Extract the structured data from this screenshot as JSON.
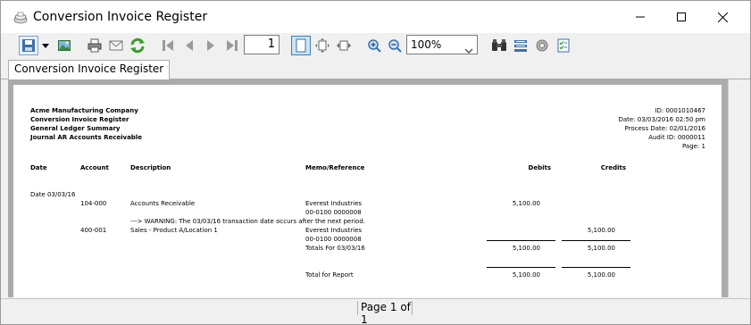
{
  "window": {
    "title": "Conversion Invoice Register",
    "controls": [
      "minimize",
      "maximize",
      "close"
    ]
  },
  "toolbar": {
    "icons": [
      "save-icon",
      "dropdown-arrow-icon",
      "export-image-icon",
      "print-icon",
      "email-icon",
      "refresh-icon",
      "first-page-icon",
      "previous-page-icon",
      "next-page-icon",
      "last-page-icon",
      "single-page-view-icon",
      "fit-page-icon",
      "fit-width-icon",
      "zoom-in-icon",
      "zoom-out-icon",
      "find-icon",
      "group-tree-icon",
      "settings-icon",
      "checklist-icon"
    ],
    "page_number": "1",
    "zoom": "100%"
  },
  "tabs": [
    {
      "label": "Conversion Invoice Register",
      "active": true
    }
  ],
  "report": {
    "header_left": [
      "Acme Manufacturing Company",
      "Conversion Invoice Register",
      "General Ledger Summary",
      "Journal AR Accounts Receivable"
    ],
    "header_right": [
      "ID: 0001010467",
      "Date: 03/03/2016 02:50 pm",
      "Process Date: 02/01/2016",
      "Audit ID: 0000011",
      "Page: 1"
    ],
    "columns": {
      "date": "Date",
      "account": "Account",
      "description": "Description",
      "memo": "Memo/Reference",
      "debits": "Debits",
      "credits": "Credits"
    },
    "group_date": "Date 03/03/16",
    "rows": [
      {
        "account": "104-000",
        "description": "Accounts Receivable",
        "memo": "Everest Industries",
        "debit": "5,100.00",
        "credit": ""
      },
      {
        "memo": "00-0100   0000008"
      },
      {
        "description": "---> WARNING: The 03/03/16 transaction date occurs after the next period."
      },
      {
        "account": "400-001",
        "description": "Sales - Product A/Location 1",
        "memo": "Everest Industries",
        "debit": "",
        "credit": "5,100.00"
      },
      {
        "memo": "00-0100   0000008"
      }
    ],
    "totals_for_label": "Totals For 03/03/16",
    "totals_for_debit": "5,100.00",
    "totals_for_credit": "5,100.00",
    "total_report_label": "Total for Report",
    "total_report_debit": "5,100.00",
    "total_report_credit": "5,100.00"
  },
  "status": {
    "page_text": "Page 1 of 1"
  }
}
